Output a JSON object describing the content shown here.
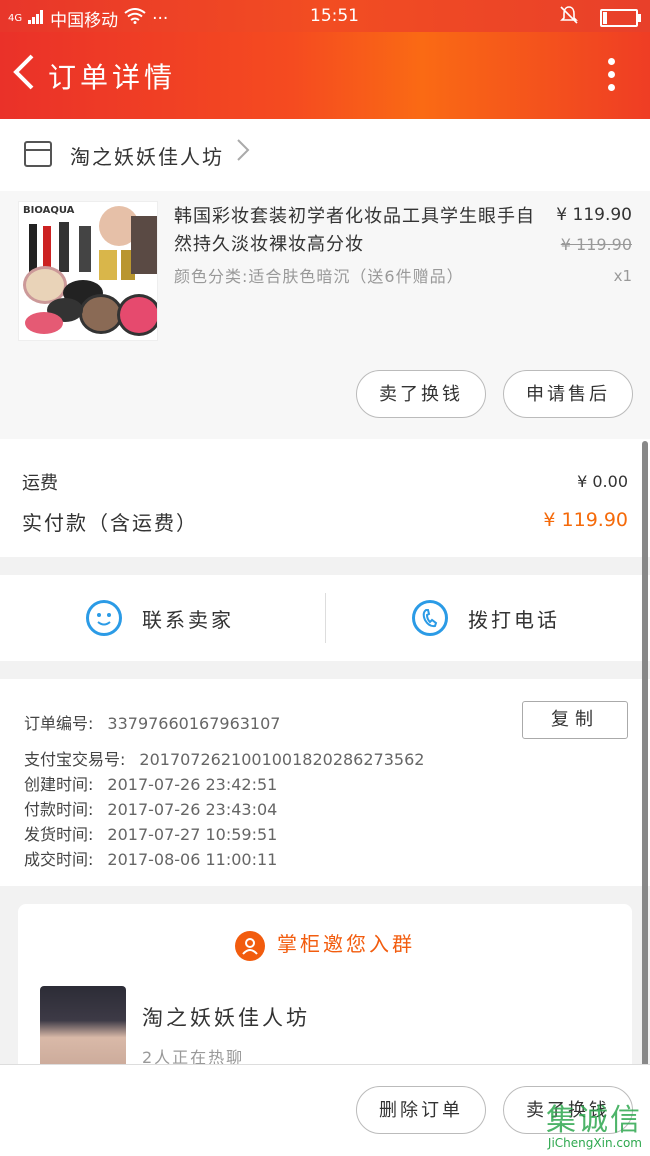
{
  "status_bar": {
    "network": "4G",
    "carrier": "中国移动",
    "dots": "···",
    "time": "15:51"
  },
  "nav": {
    "title": "订单详情"
  },
  "shop": {
    "name": "淘之妖妖佳人坊"
  },
  "item": {
    "thumb_brand": "BIOAQUA",
    "title": "韩国彩妆套装初学者化妆品工具学生眼手自然持久淡妆裸妆高分妆",
    "spec": "颜色分类:适合肤色暗沉（送6件赠品）",
    "price": "¥ 119.90",
    "original_price": "¥ 119.90",
    "quantity": "x1",
    "btn_return": "卖了换钱",
    "btn_after_sale": "申请售后"
  },
  "fees": {
    "shipping_label": "运费",
    "shipping_value": "¥ 0.00",
    "paid_label": "实付款（含运费）",
    "paid_value": "¥ 119.90"
  },
  "contact": {
    "seller_label": "联系卖家",
    "call_label": "拨打电话"
  },
  "order_info": {
    "copy_label": "复制",
    "rows": [
      {
        "label": "订单编号:",
        "value": "33797660167963107"
      },
      {
        "label": "支付宝交易号:",
        "value": "2017072621001001820286273562"
      },
      {
        "label": "创建时间:",
        "value": "2017-07-26 23:42:51"
      },
      {
        "label": "付款时间:",
        "value": "2017-07-26 23:43:04"
      },
      {
        "label": "发货时间:",
        "value": "2017-07-27 10:59:51"
      },
      {
        "label": "成交时间:",
        "value": "2017-08-06 11:00:11"
      }
    ]
  },
  "group": {
    "header": "掌柜邀您入群",
    "name": "淘之妖妖佳人坊",
    "subtitle": "2人正在热聊"
  },
  "bottom": {
    "delete_label": "删除订单",
    "sell_label": "卖了换钱"
  },
  "watermark": {
    "logo": "集诚信",
    "site": "JiChengXin.com"
  },
  "colors": {
    "header_red": "#ea3129",
    "accent_orange": "#f56a0a",
    "icon_blue": "#2b9be6"
  }
}
